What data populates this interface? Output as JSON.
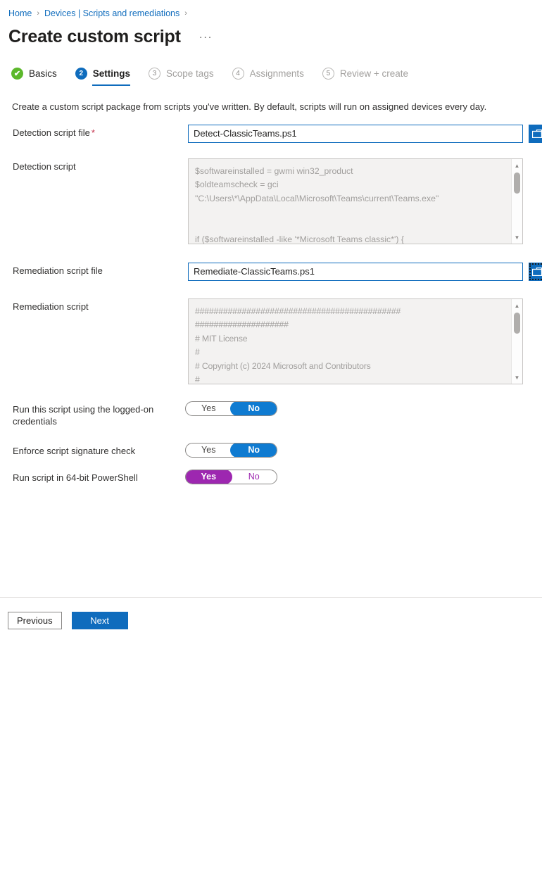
{
  "breadcrumb": {
    "items": [
      {
        "label": "Home"
      },
      {
        "label": "Devices | Scripts and remediations"
      }
    ],
    "separator": "›",
    "trailing_separator": "›"
  },
  "header": {
    "title": "Create custom script",
    "ellipsis": "···"
  },
  "wizard": {
    "steps": [
      {
        "number": "✔",
        "label": "Basics",
        "state": "done"
      },
      {
        "number": "2",
        "label": "Settings",
        "state": "current"
      },
      {
        "number": "3",
        "label": "Scope tags",
        "state": "todo"
      },
      {
        "number": "4",
        "label": "Assignments",
        "state": "todo"
      },
      {
        "number": "5",
        "label": "Review + create",
        "state": "todo"
      }
    ]
  },
  "main": {
    "description": "Create a custom script package from scripts you've written. By default, scripts will run on assigned devices every day.",
    "fields": {
      "detection_script_file": {
        "label": "Detection script file",
        "required_marker": "*",
        "value": "Detect-ClassicTeams.ps1",
        "browse_icon": "folder-browse-icon"
      },
      "detection_script": {
        "label": "Detection script",
        "value": "$softwareinstalled = gwmi win32_product\n$oldteamscheck = gci\n\"C:\\Users\\*\\AppData\\Local\\Microsoft\\Teams\\current\\Teams.exe\"\n\n\nif ($softwareinstalled -like '*Microsoft Teams classic*') {\n    Write-host \"Microsoft Teams CLassic found on device or user.. proceeding to"
      },
      "remediation_script_file": {
        "label": "Remediation script file",
        "value": "Remediate-ClassicTeams.ps1",
        "browse_icon": "folder-browse-icon"
      },
      "remediation_script": {
        "label": "Remediation script",
        "value": "############################################\n####################\n# MIT License\n#\n# Copyright (c) 2024 Microsoft and Contributors\n#\n# Permission is hereby granted, free of charge, to any person obtaining a copy"
      }
    },
    "toggles": [
      {
        "label": "Run this script using the logged-on credentials",
        "yes_label": "Yes",
        "no_label": "No",
        "selected": "No"
      },
      {
        "label": "Enforce script signature check",
        "yes_label": "Yes",
        "no_label": "No",
        "selected": "No"
      },
      {
        "label": "Run script in 64-bit PowerShell",
        "yes_label": "Yes",
        "no_label": "No",
        "selected": "Yes"
      }
    ]
  },
  "footer": {
    "previous_label": "Previous",
    "next_label": "Next"
  },
  "colors": {
    "accent_blue": "#0f6cbd",
    "toggle_blue": "#0f7bd1",
    "toggle_purple": "#9d27b0",
    "success_green": "#5cb82b",
    "required_red": "#c4314b"
  }
}
